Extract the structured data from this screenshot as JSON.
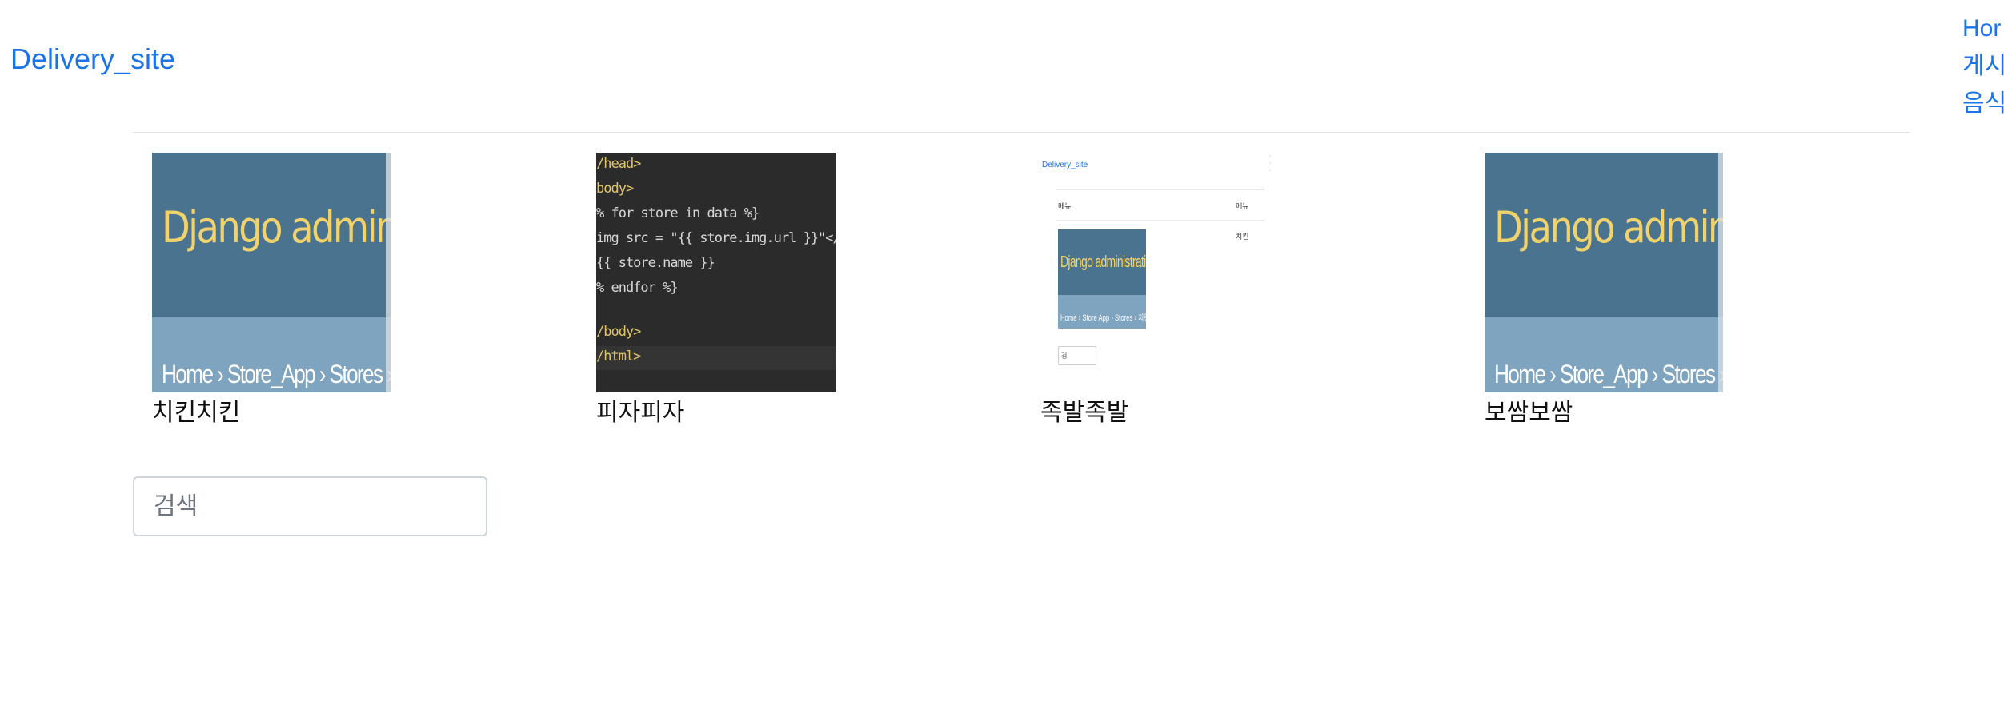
{
  "brand": "Delivery_site",
  "nav": {
    "items": [
      "Hor",
      "게시",
      "음식"
    ]
  },
  "stores": [
    {
      "name": "치킨치킨",
      "thumb": {
        "title": "Django administration",
        "crumb": "Home › Store_App › Stores › 치킨치킨"
      }
    },
    {
      "name": "피자피자",
      "thumb": {
        "lines": [
          "/head>",
          "body>",
          "% for store in data %}",
          "img src = \"{{ store.img.url }}\"</img><br>",
          "   {{ store.name }}",
          "% endfor %}",
          "",
          "/body>",
          "/html>"
        ]
      }
    },
    {
      "name": "족발족발",
      "thumb": {
        "brand": "Delivery_site",
        "col1": "메뉴",
        "col2": "메뉴",
        "col3": "치킨",
        "img_title": "Django administration",
        "img_crumb": "Home › Store App › Stores › 치킨치킨",
        "input": "검"
      }
    },
    {
      "name": "보쌈보쌈",
      "thumb": {
        "title": "Django administration",
        "crumb": "Home › Store_App › Stores › 치킨치킨"
      }
    }
  ],
  "search": {
    "placeholder": "검색"
  }
}
